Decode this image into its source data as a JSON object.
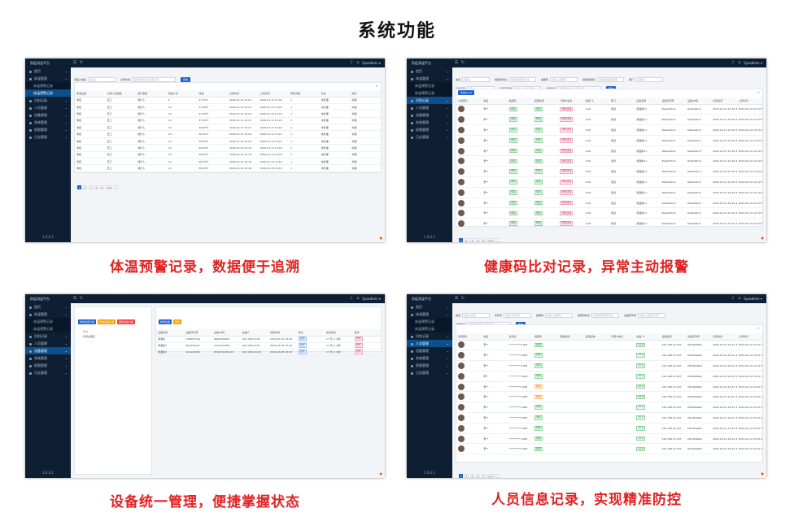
{
  "page_title": "系统功能",
  "common": {
    "app_title": "防疫测温平台",
    "user_name": "Sysadmin",
    "version": "1.0.0.1",
    "search_button": "查询",
    "close_symbol": "×",
    "sidebar": [
      {
        "label": "首页",
        "type": "item"
      },
      {
        "label": "体温管理",
        "type": "item"
      },
      {
        "label": "体温预警记录",
        "type": "sub"
      },
      {
        "label": "体温预警记录",
        "type": "sub"
      },
      {
        "label": "识别记录",
        "type": "item"
      },
      {
        "label": "人员管理",
        "type": "item"
      },
      {
        "label": "设备管理",
        "type": "item"
      },
      {
        "label": "系统管理",
        "type": "item"
      },
      {
        "label": "权限管理",
        "type": "item"
      },
      {
        "label": "日志管理",
        "type": "item"
      }
    ]
  },
  "panels": [
    {
      "caption": "体温预警记录，数据便于追溯",
      "filters": [
        {
          "label": "测温人姓名",
          "placeholder": "请输入"
        },
        {
          "label": "记录时间",
          "placeholder": "选择开始时间-结束时间"
        }
      ],
      "columns": [
        "测温设备",
        "记录人员类型",
        "通行类型",
        "测温人员",
        "体温",
        "记录时间",
        "上传时间",
        "预警次数",
        "状态",
        "操作"
      ],
      "rows": [
        [
          "测控",
          "员工",
          "通行人",
          "5",
          "37.30℃",
          "2020-01-13 15:01",
          "2020-01-13 15:02",
          "1",
          "未处理",
          "处理"
        ],
        [
          "测控",
          "员工",
          "通行人",
          "10",
          "37.80℃",
          "2020-01-13 14:23",
          "2020-01-13 14:24",
          "1",
          "未处理",
          "处理"
        ],
        [
          "测控",
          "员工",
          "通行人",
          "10",
          "37.90℃",
          "2020-01-13 14:22",
          "2020-01-13 14:23",
          "1",
          "未处理",
          "处理"
        ],
        [
          "测控",
          "员工",
          "通行人",
          "10",
          "37.30℃",
          "2020-01-13 14:21",
          "2020-01-13 14:22",
          "1",
          "未处理",
          "处理"
        ],
        [
          "测控",
          "员工",
          "通行人",
          "10",
          "36.60℃",
          "2020-01-13 14:21",
          "2020-01-13 14:22",
          "1",
          "未处理",
          "处理"
        ],
        [
          "测控",
          "员工",
          "通行人",
          "10",
          "38.30℃",
          "2020-01-13 14:20",
          "2020-01-13 14:21",
          "1",
          "未处理",
          "处理"
        ],
        [
          "测控",
          "员工",
          "通行人",
          "10",
          "36.60℃",
          "2020-01-13 14:20",
          "2020-01-13 14:21",
          "1",
          "未处理",
          "处理"
        ],
        [
          "测控",
          "员工",
          "通行人",
          "10",
          "36.60℃",
          "2020-01-13 14:19",
          "2020-01-13 14:20",
          "1",
          "未处理",
          "处理"
        ],
        [
          "测控",
          "员工",
          "通行人",
          "10",
          "38.60℃",
          "2020-01-13 14:19",
          "2020-01-13 14:20",
          "1",
          "未处理",
          "处理"
        ],
        [
          "测控",
          "员工",
          "通行人",
          "10",
          "38.40℃",
          "2020-01-13 14:18",
          "2020-01-13 14:19",
          "1",
          "未处理",
          "处理"
        ],
        [
          "测控",
          "员工",
          "通行人",
          "10",
          "36.80℃",
          "2020-01-13 14:18",
          "2020-01-13 14:19",
          "1",
          "未处理",
          "处理"
        ]
      ],
      "pager": [
        "1",
        "2",
        "3",
        "4",
        "5",
        "100",
        "›"
      ]
    },
    {
      "caption": "健康码比对记录，异常主动报警",
      "filters": [
        {
          "label": "姓名",
          "placeholder": "请输入"
        },
        {
          "label": "健康码状态",
          "placeholder": "请选择健康码状态"
        },
        {
          "label": "健康码",
          "placeholder": "请输入健康码"
        },
        {
          "label": "健康码类型",
          "placeholder": "请选择健康码类型"
        },
        {
          "label": "部门",
          "placeholder": "请选择"
        }
      ],
      "filters2": [
        {
          "label": "设备名称",
          "placeholder": "请输入"
        },
        {
          "label": "设备序列号",
          "placeholder": "请输入设备序列号"
        },
        {
          "label": "记录时间",
          "placeholder": "选择开始时间-结束时间"
        }
      ],
      "export_button": "导出Excel",
      "columns": [
        "识别照片",
        "姓名",
        "健康码",
        "核酸检测",
        "行程卡信息",
        "体温 ℃",
        "部门",
        "设备名称",
        "设备序列号",
        "设备SN码",
        "识别时间",
        "上传时间"
      ],
      "row_name": "李**",
      "row_code": "绿码",
      "row_status": "阴性",
      "row_trip": "绿色通道",
      "row_temp": "0.00",
      "row_dept": "测试",
      "row_device": "测温机01",
      "row_sn": "8ae0d2bc0",
      "row_time": "2022-02-14 10:19:35",
      "row_count": 12,
      "pager": [
        "1",
        "2",
        "3",
        "4",
        "5",
        "273",
        "›"
      ]
    },
    {
      "caption": "设备统一管理，便捷掌握状态",
      "top_buttons": [
        {
          "label": "新增设备分组",
          "color": "#1d5fd0"
        },
        {
          "label": "修改设备分组",
          "color": "#f59f00"
        },
        {
          "label": "删除设备分组",
          "color": "#f03e3e"
        }
      ],
      "tree": [
        {
          "label": "测试",
          "highlight": true
        },
        {
          "label": "华南总部区",
          "highlight": false
        }
      ],
      "right_buttons": [
        {
          "label": "新增设备",
          "color": "#1d5fd0"
        },
        {
          "label": "删除",
          "color": "#f59f00"
        }
      ],
      "columns": [
        "设备名称",
        "设备序列号",
        "设备SN码",
        "设备IP",
        "创建时间",
        "状态",
        "在线时长",
        "操作"
      ],
      "rows": [
        [
          "测温机",
          "5366507AG",
          "0B202S4006",
          "192.168.10.18",
          "2020-03-21 15:49",
          "在线",
          "17 天 4 小时",
          "详情"
        ],
        [
          "测温机2",
          "8ae0d2bc0",
          "unkwn4dh5a",
          "192.168.10.67",
          "2020-03-05 15:44",
          "在线",
          "17 天 5 小时",
          "详情"
        ],
        [
          "测温机3",
          "2a7a4d0d4",
          "ZTOZO1020120",
          "192.168.10.167",
          "2020-03-03 16:32",
          "在线",
          "17 天 1 小时",
          "详情"
        ]
      ]
    },
    {
      "caption": "人员信息记录，实现精准防控",
      "filters": [
        {
          "label": "姓名",
          "placeholder": "请输入姓名"
        },
        {
          "label": "手机号",
          "placeholder": "请输入手机号"
        },
        {
          "label": "健康码",
          "placeholder": "请输入健康码"
        },
        {
          "label": "健康码状态",
          "placeholder": "请选择健康码状态"
        },
        {
          "label": "设备序列号",
          "placeholder": "请输入设备序列号"
        }
      ],
      "filters2": [
        {
          "label": "记录时间",
          "placeholder": "选择开始时间-结束时间"
        }
      ],
      "columns": [
        "识别照片",
        "姓名",
        "身份证",
        "健康码",
        "核酸检测",
        "疫苗接种",
        "行程卡信息",
        "体温 ℃",
        "设备名称",
        "设备序列号",
        "识别时间",
        "上传时间"
      ],
      "row_name": "李**",
      "row_id": "**********1208",
      "row_code": "绿码",
      "row_code_alt": "黄码",
      "row_temp": "36.8",
      "row_device": "192.168.10.187",
      "row_sn": "2f1e69a8e0",
      "row_time": "2022-02-14 10:21:36",
      "row_count": 11,
      "pager": [
        "1",
        "2",
        "3",
        "4",
        "5",
        "112",
        "›"
      ]
    }
  ]
}
